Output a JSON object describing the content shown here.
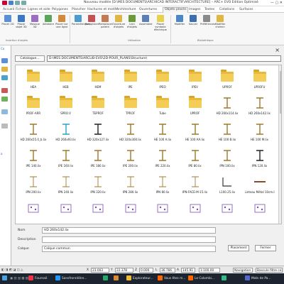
{
  "window": {
    "title": "Nouveau modèle [D:\\MES DOCUMENTS\\ARCHICAD INTERACTIF\\ARCHITECTURE] – ARC+ EVO Edition Optimisé"
  },
  "tabs": [
    "Accueil",
    "Fichier",
    "Lignes et aide",
    "Polygones",
    "Plancher",
    "Hachures et motifs",
    "Architecture",
    "Ouvertures",
    "Objets placés",
    "Images",
    "Textes",
    "Cotations",
    "Surfaces"
  ],
  "active_tab": "Objets placés",
  "ribbon": {
    "buttons": [
      "Placer 2D",
      "Placer objet 3D",
      "Masque 3D",
      "Aléatoire",
      "Placer sur une ligne",
      "Paramétriques",
      "Remplacer",
      "Remplacer parent",
      "Ouverture d'objets",
      "Lien d'objets",
      "Assembler",
      "Placer symbole électrique",
      "Modifier",
      "Sauver",
      "Préférences",
      "Modifier chemin"
    ],
    "groups": [
      "Insertion d'objets",
      "Utilisation",
      "Bibliothèque"
    ]
  },
  "left_panel": {
    "items": [
      "Co",
      "a"
    ]
  },
  "catalogue": {
    "button_label": "Catalogue...",
    "path": "D:\\MES DOCUMENTS\\ARCLIB-EVO\\2D-POUR_PLANS\\Structure\\",
    "close_label": "×"
  },
  "items": [
    {
      "label": "HEA",
      "kind": "folder"
    },
    {
      "label": "HEB",
      "kind": "folder"
    },
    {
      "label": "HEM",
      "kind": "folder"
    },
    {
      "label": "IPE",
      "kind": "folder"
    },
    {
      "label": "IPEO",
      "kind": "folder"
    },
    {
      "label": "IPEV",
      "kind": "folder"
    },
    {
      "label": "UPROF",
      "kind": "folder"
    },
    {
      "label": "LPROFU",
      "kind": "folder"
    },
    {
      "label": "PROF-ARR",
      "kind": "folder"
    },
    {
      "label": "SPRO.V",
      "kind": "folder"
    },
    {
      "label": "TEPROF",
      "kind": "folder"
    },
    {
      "label": "TPROF",
      "kind": "folder"
    },
    {
      "label": "Tube",
      "kind": "folder"
    },
    {
      "label": "UPROF",
      "kind": "folder"
    },
    {
      "label": "HD 260x114.lix",
      "kind": "beam"
    },
    {
      "label": "HD 260x142.lix",
      "kind": "beam"
    },
    {
      "label": "HD 260x55.0_b.lix",
      "kind": "beam"
    },
    {
      "label": "HD 260x93.lix",
      "kind": "beam-cyan"
    },
    {
      "label": "HD 320x127.lix",
      "kind": "beam-black"
    },
    {
      "label": "HD 320x300.lix",
      "kind": "beam"
    },
    {
      "label": "HE 100 A.lix",
      "kind": "beam"
    },
    {
      "label": "HE 100 AA.lix",
      "kind": "beam"
    },
    {
      "label": "HE 100 B.lix",
      "kind": "beam"
    },
    {
      "label": "HE 100 M.lix",
      "kind": "beam"
    },
    {
      "label": "IPE 140.lix",
      "kind": "beam"
    },
    {
      "label": "IPE 160.lix",
      "kind": "beam"
    },
    {
      "label": "IPE 180.lix",
      "kind": "beam"
    },
    {
      "label": "IPE 200.lix",
      "kind": "beam"
    },
    {
      "label": "IPE 220.lix",
      "kind": "beam"
    },
    {
      "label": "IPE 80.lix",
      "kind": "beam"
    },
    {
      "label": "IPN 100.lix",
      "kind": "beam"
    },
    {
      "label": "IPN 120.lix",
      "kind": "beam-black"
    },
    {
      "label": "IPN 200.lix",
      "kind": "beam-thin"
    },
    {
      "label": "IPN 240.lix",
      "kind": "beam-thin"
    },
    {
      "label": "IPN 320.lix",
      "kind": "beam-thin"
    },
    {
      "label": "IPN 280.lix",
      "kind": "beam-thin"
    },
    {
      "label": "IPN 80.lix",
      "kind": "beam-thin"
    },
    {
      "label": "IPN-FACE-M-15.lix",
      "kind": "beam-thin"
    },
    {
      "label": "L100.25.lix",
      "kind": "angle"
    },
    {
      "label": "Linteau Métal 10cm.lix",
      "kind": "lintel"
    },
    {
      "label": "",
      "kind": "plate-a"
    },
    {
      "label": "",
      "kind": "plate-b"
    },
    {
      "label": "",
      "kind": "plate-c"
    },
    {
      "label": "",
      "kind": "plate-d"
    },
    {
      "label": "",
      "kind": "plate-e"
    },
    {
      "label": "",
      "kind": "plate-f"
    },
    {
      "label": "",
      "kind": "plate-g"
    },
    {
      "label": "",
      "kind": "plate-h"
    }
  ],
  "properties": {
    "name_label": "Nom",
    "name_value": "HD 260x142.lix",
    "description_label": "Description",
    "description_value": "",
    "layer_label": "Calque",
    "layer_value": "Calque commun",
    "place_button": "Placement",
    "cancel_button": "Fermer"
  },
  "status": {
    "x": "23.003",
    "y": "22.378",
    "z": "0.000",
    "l": "36.766",
    "angle": "145.91",
    "scale": "1:100.00",
    "mode": "Navigation",
    "filter": "Bascule filtre ce"
  },
  "taskbar": {
    "items": [
      "Fournaë",
      "Sansfronntière...",
      "",
      "",
      "Explorateur...",
      "Vous êtes m...",
      "Le Colombi...",
      "",
      "Mots de Pa..."
    ]
  }
}
